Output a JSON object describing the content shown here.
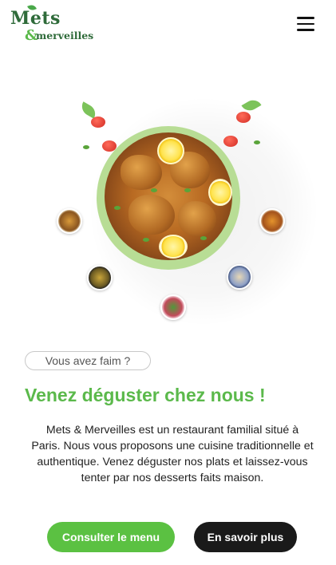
{
  "header": {
    "logo_line1": "Mets",
    "logo_amp": "&",
    "logo_line2": "merveilles",
    "menu_icon": "hamburger-menu-icon"
  },
  "hero": {
    "plate_image": "roasted-chicken-lemon-plate",
    "side_dishes": [
      "side-dish-1",
      "side-dish-2",
      "side-dish-3",
      "side-dish-4",
      "side-dish-5"
    ]
  },
  "main": {
    "tag": "Vous avez faim ?",
    "title": "Venez déguster chez nous !",
    "description": "Mets & Merveilles est un restaurant familial situé à Paris. Nous vous proposons une cuisine traditionnelle et authentique. Venez déguster nos plats et laissez-vous tenter par nos desserts faits maison.",
    "btn_menu": "Consulter le menu",
    "btn_more": "En savoir plus"
  },
  "colors": {
    "brand_green": "#5bb94b",
    "dark_green": "#2f6b3a",
    "button_dark": "#1a1a1a"
  }
}
